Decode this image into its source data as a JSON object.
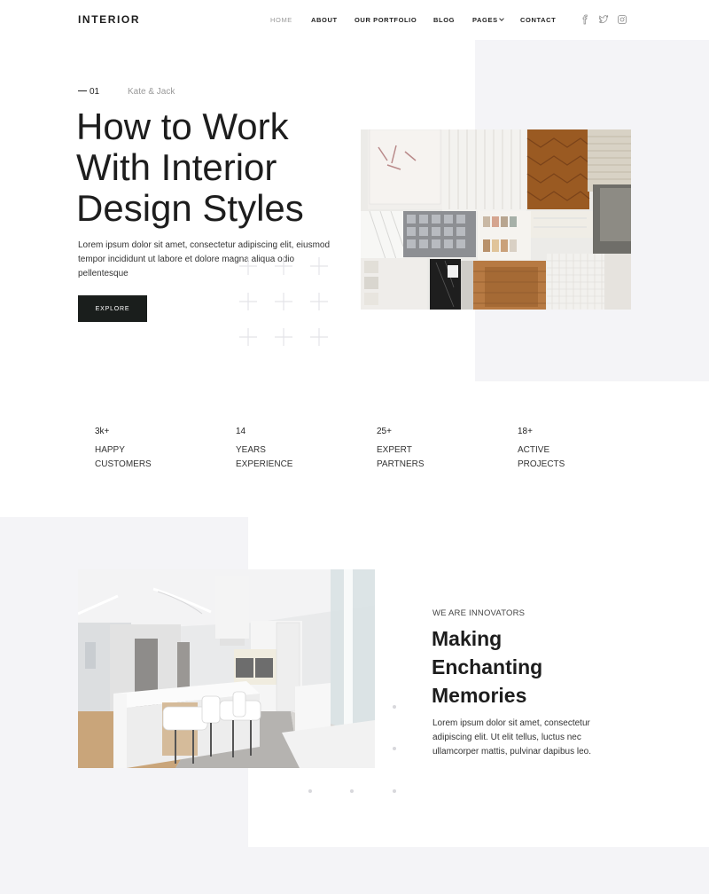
{
  "header": {
    "logo": "INTERIOR",
    "nav": [
      {
        "label": "HOME",
        "active": true
      },
      {
        "label": "ABOUT",
        "active": false
      },
      {
        "label": "OUR PORTFOLIO",
        "active": false
      },
      {
        "label": "BLOG",
        "active": false
      },
      {
        "label": "PAGES",
        "active": false,
        "icon": "chevron-down-icon"
      },
      {
        "label": "CONTACT",
        "active": false
      }
    ],
    "social_icons": [
      "facebook-icon",
      "twitter-icon",
      "instagram-icon"
    ]
  },
  "hero": {
    "index": "01",
    "author": "Kate & Jack",
    "title": "How to Work With Interior Design Styles",
    "text": "Lorem ipsum dolor sit amet, consectetur adipiscing elit, eiusmod tempor incididunt ut labore et dolore magna aliqua odio pellentesque",
    "button": "EXPLORE",
    "image": "material-samples-photo"
  },
  "stats": [
    {
      "value": "3k+",
      "label": "HAPPY CUSTOMERS"
    },
    {
      "value": "14",
      "label": "YEARS EXPERIENCE"
    },
    {
      "value": "25+",
      "label": "EXPERT PARTNERS"
    },
    {
      "value": "18+",
      "label": "ACTIVE PROJECTS"
    }
  ],
  "feature": {
    "image": "white-kitchen-photo",
    "kicker": "WE ARE INNOVATORS",
    "title": "Making Enchanting Memories",
    "text": "Lorem ipsum dolor sit amet, consectetur adipiscing elit. Ut elit tellus, luctus nec ullamcorper mattis, pulvinar dapibus leo."
  },
  "colors": {
    "dark": "#1a1e1c",
    "muted": "#9a9a9a",
    "panel": "#f4f4f7"
  }
}
